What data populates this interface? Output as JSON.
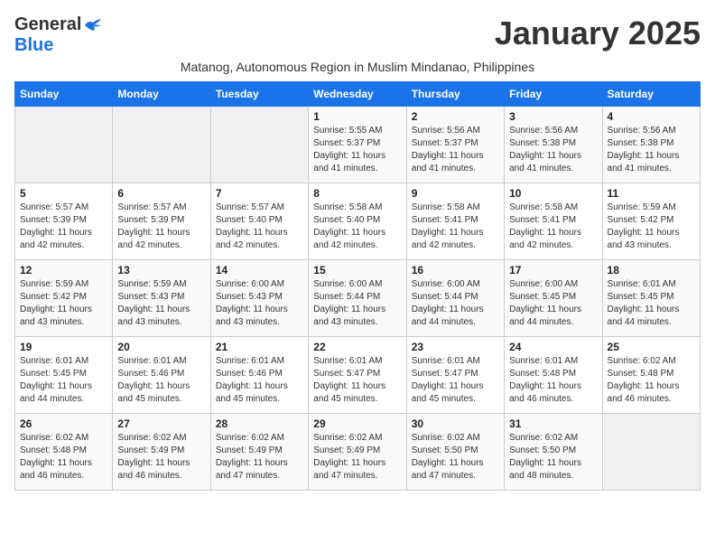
{
  "header": {
    "logo_general": "General",
    "logo_blue": "Blue",
    "month_title": "January 2025",
    "subtitle": "Matanog, Autonomous Region in Muslim Mindanao, Philippines"
  },
  "weekdays": [
    "Sunday",
    "Monday",
    "Tuesday",
    "Wednesday",
    "Thursday",
    "Friday",
    "Saturday"
  ],
  "weeks": [
    [
      {
        "day": "",
        "info": ""
      },
      {
        "day": "",
        "info": ""
      },
      {
        "day": "",
        "info": ""
      },
      {
        "day": "1",
        "info": "Sunrise: 5:55 AM\nSunset: 5:37 PM\nDaylight: 11 hours\nand 41 minutes."
      },
      {
        "day": "2",
        "info": "Sunrise: 5:56 AM\nSunset: 5:37 PM\nDaylight: 11 hours\nand 41 minutes."
      },
      {
        "day": "3",
        "info": "Sunrise: 5:56 AM\nSunset: 5:38 PM\nDaylight: 11 hours\nand 41 minutes."
      },
      {
        "day": "4",
        "info": "Sunrise: 5:56 AM\nSunset: 5:38 PM\nDaylight: 11 hours\nand 41 minutes."
      }
    ],
    [
      {
        "day": "5",
        "info": "Sunrise: 5:57 AM\nSunset: 5:39 PM\nDaylight: 11 hours\nand 42 minutes."
      },
      {
        "day": "6",
        "info": "Sunrise: 5:57 AM\nSunset: 5:39 PM\nDaylight: 11 hours\nand 42 minutes."
      },
      {
        "day": "7",
        "info": "Sunrise: 5:57 AM\nSunset: 5:40 PM\nDaylight: 11 hours\nand 42 minutes."
      },
      {
        "day": "8",
        "info": "Sunrise: 5:58 AM\nSunset: 5:40 PM\nDaylight: 11 hours\nand 42 minutes."
      },
      {
        "day": "9",
        "info": "Sunrise: 5:58 AM\nSunset: 5:41 PM\nDaylight: 11 hours\nand 42 minutes."
      },
      {
        "day": "10",
        "info": "Sunrise: 5:58 AM\nSunset: 5:41 PM\nDaylight: 11 hours\nand 42 minutes."
      },
      {
        "day": "11",
        "info": "Sunrise: 5:59 AM\nSunset: 5:42 PM\nDaylight: 11 hours\nand 43 minutes."
      }
    ],
    [
      {
        "day": "12",
        "info": "Sunrise: 5:59 AM\nSunset: 5:42 PM\nDaylight: 11 hours\nand 43 minutes."
      },
      {
        "day": "13",
        "info": "Sunrise: 5:59 AM\nSunset: 5:43 PM\nDaylight: 11 hours\nand 43 minutes."
      },
      {
        "day": "14",
        "info": "Sunrise: 6:00 AM\nSunset: 5:43 PM\nDaylight: 11 hours\nand 43 minutes."
      },
      {
        "day": "15",
        "info": "Sunrise: 6:00 AM\nSunset: 5:44 PM\nDaylight: 11 hours\nand 43 minutes."
      },
      {
        "day": "16",
        "info": "Sunrise: 6:00 AM\nSunset: 5:44 PM\nDaylight: 11 hours\nand 44 minutes."
      },
      {
        "day": "17",
        "info": "Sunrise: 6:00 AM\nSunset: 5:45 PM\nDaylight: 11 hours\nand 44 minutes."
      },
      {
        "day": "18",
        "info": "Sunrise: 6:01 AM\nSunset: 5:45 PM\nDaylight: 11 hours\nand 44 minutes."
      }
    ],
    [
      {
        "day": "19",
        "info": "Sunrise: 6:01 AM\nSunset: 5:45 PM\nDaylight: 11 hours\nand 44 minutes."
      },
      {
        "day": "20",
        "info": "Sunrise: 6:01 AM\nSunset: 5:46 PM\nDaylight: 11 hours\nand 45 minutes."
      },
      {
        "day": "21",
        "info": "Sunrise: 6:01 AM\nSunset: 5:46 PM\nDaylight: 11 hours\nand 45 minutes."
      },
      {
        "day": "22",
        "info": "Sunrise: 6:01 AM\nSunset: 5:47 PM\nDaylight: 11 hours\nand 45 minutes."
      },
      {
        "day": "23",
        "info": "Sunrise: 6:01 AM\nSunset: 5:47 PM\nDaylight: 11 hours\nand 45 minutes."
      },
      {
        "day": "24",
        "info": "Sunrise: 6:01 AM\nSunset: 5:48 PM\nDaylight: 11 hours\nand 46 minutes."
      },
      {
        "day": "25",
        "info": "Sunrise: 6:02 AM\nSunset: 5:48 PM\nDaylight: 11 hours\nand 46 minutes."
      }
    ],
    [
      {
        "day": "26",
        "info": "Sunrise: 6:02 AM\nSunset: 5:48 PM\nDaylight: 11 hours\nand 46 minutes."
      },
      {
        "day": "27",
        "info": "Sunrise: 6:02 AM\nSunset: 5:49 PM\nDaylight: 11 hours\nand 46 minutes."
      },
      {
        "day": "28",
        "info": "Sunrise: 6:02 AM\nSunset: 5:49 PM\nDaylight: 11 hours\nand 47 minutes."
      },
      {
        "day": "29",
        "info": "Sunrise: 6:02 AM\nSunset: 5:49 PM\nDaylight: 11 hours\nand 47 minutes."
      },
      {
        "day": "30",
        "info": "Sunrise: 6:02 AM\nSunset: 5:50 PM\nDaylight: 11 hours\nand 47 minutes."
      },
      {
        "day": "31",
        "info": "Sunrise: 6:02 AM\nSunset: 5:50 PM\nDaylight: 11 hours\nand 48 minutes."
      },
      {
        "day": "",
        "info": ""
      }
    ]
  ]
}
